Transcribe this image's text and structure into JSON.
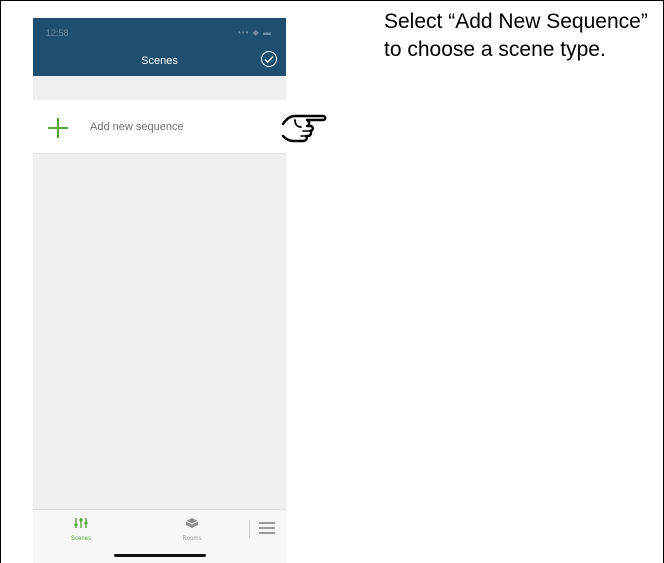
{
  "status": {
    "time": "12:58",
    "icons": "••• ◆ ▬"
  },
  "nav": {
    "title": "Scenes"
  },
  "add_row": {
    "label": "Add new sequence"
  },
  "tabs": [
    {
      "label": "Scenes",
      "active": true
    },
    {
      "label": "Rooms",
      "active": false
    }
  ],
  "instruction": {
    "text": "Select “Add New Sequence” to choose a scene type."
  },
  "colors": {
    "nav": "#1f4e6e",
    "accent": "#5aa63a",
    "background": "#efeff0"
  }
}
